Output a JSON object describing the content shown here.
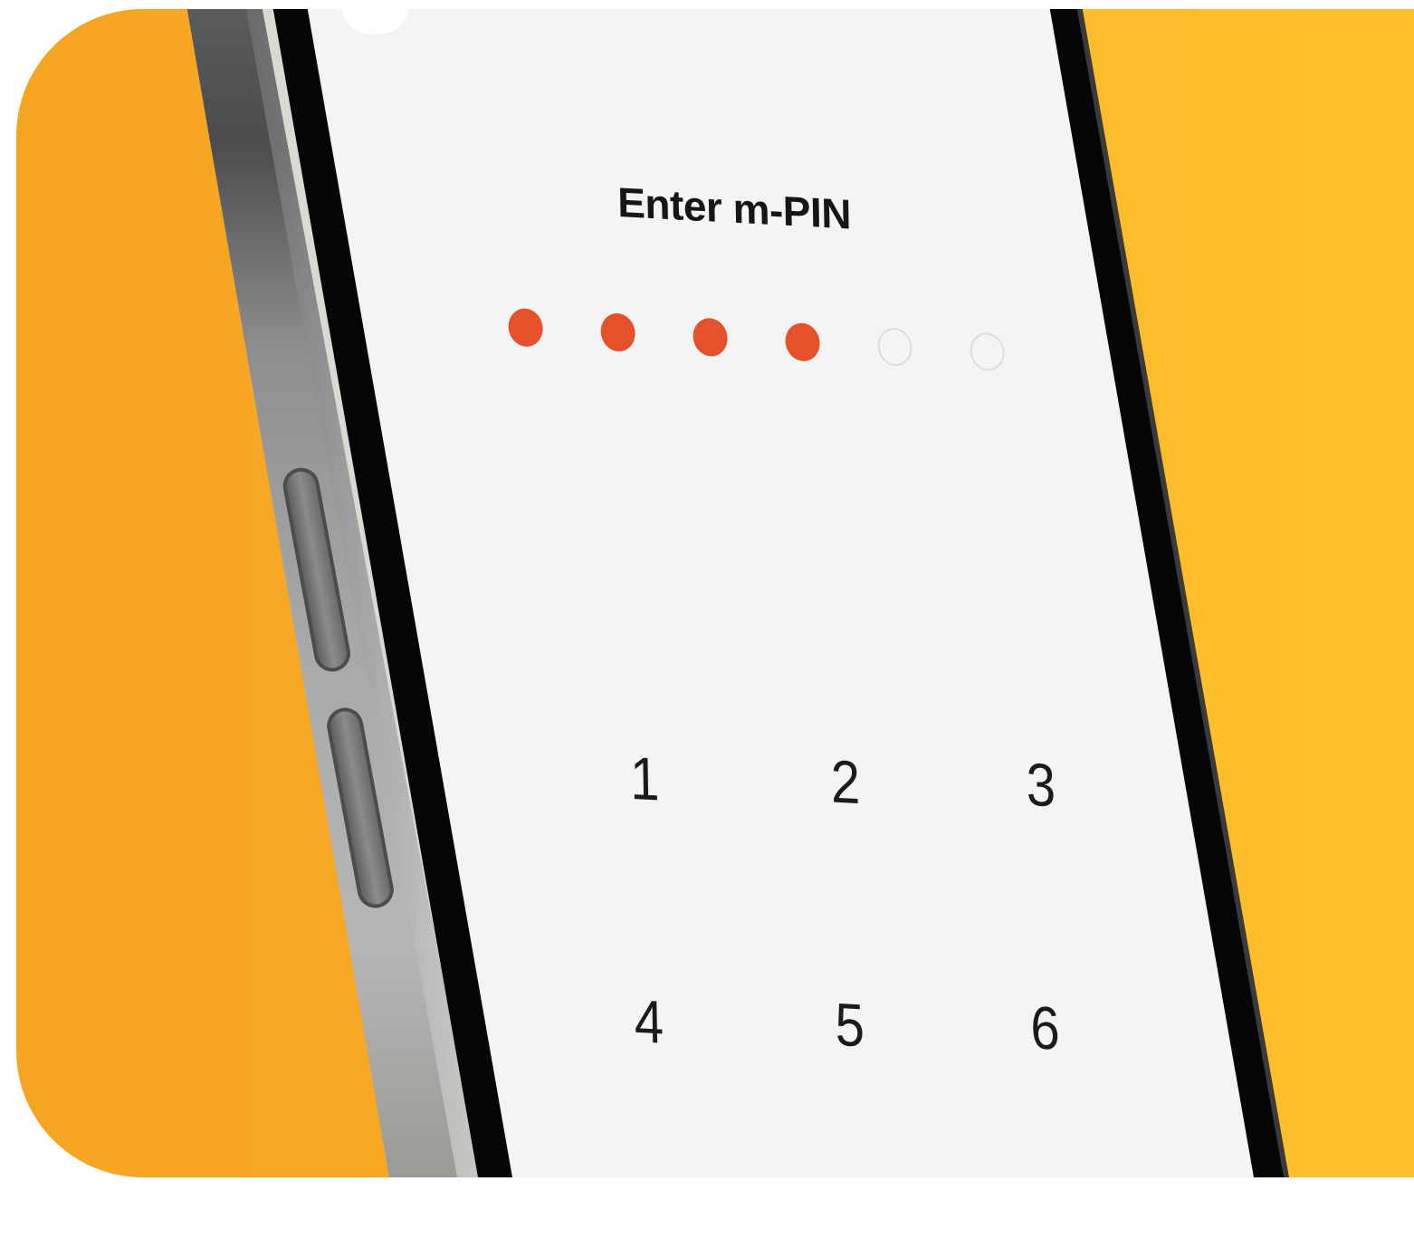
{
  "screen": {
    "title": "Enter m-PIN"
  },
  "pin": {
    "total_digits": 6,
    "entered_digits": 4,
    "filled_color": "#e5512a",
    "empty_border_color": "#dcdcdc"
  },
  "keypad": {
    "keys": [
      "1",
      "2",
      "3",
      "4",
      "5",
      "6"
    ]
  },
  "colors": {
    "background_left": "#f6a522",
    "background_right": "#fec12b",
    "screen": "#f4f4f4",
    "bezel": "#050505"
  }
}
